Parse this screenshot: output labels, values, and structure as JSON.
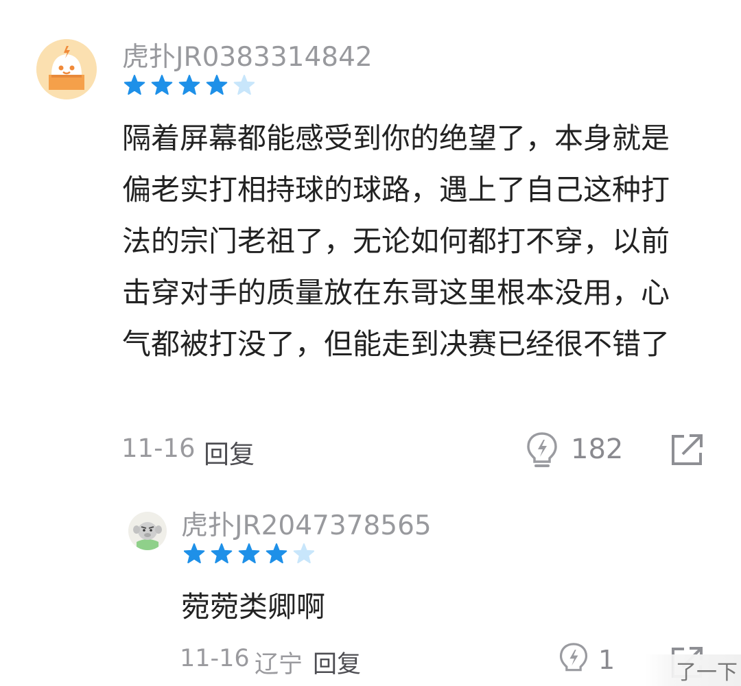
{
  "comment": {
    "username": "虎扑JR0383314842",
    "rating": 4.5,
    "text": "隔着屏幕都能感受到你的绝望了，本身就是偏老实打相持球的球路，遇上了自己这种打法的宗门老祖了，无论如何都打不穿，以前击穿对手的质量放在东哥这里根本没用，心气都被打没了，但能走到决赛已经很不错了",
    "date": "11-16",
    "reply_label": "回复",
    "likes": "182",
    "like_icon": "lightbulb-icon",
    "share_icon": "share-icon"
  },
  "reply": {
    "username": "虎扑JR2047378565",
    "rating": 4.5,
    "text": "菀菀类卿啊",
    "date": "11-16",
    "location": "辽宁",
    "reply_label": "回复",
    "likes": "1"
  },
  "watermark": {
    "text": "了一下"
  },
  "colors": {
    "star": "#1e90e8",
    "star_empty": "#c8e6fb",
    "username": "#98999d",
    "text": "#222222",
    "meta": "#9a9a9e"
  }
}
